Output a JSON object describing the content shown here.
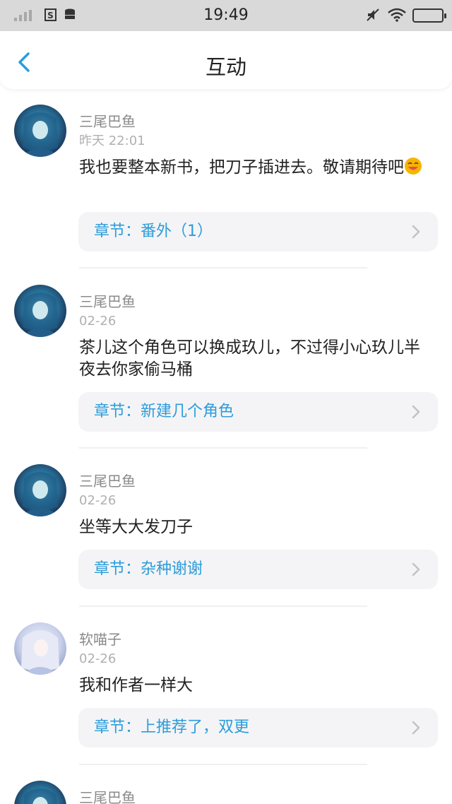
{
  "status_bar": {
    "time": "19:49",
    "icons": [
      "signal-icon",
      "sim-icon",
      "data-icon",
      "mute-icon",
      "wifi-icon",
      "battery-icon"
    ]
  },
  "nav": {
    "title": "互动",
    "back_icon": "chevron-left-icon"
  },
  "accent_color": "#2d9cdb",
  "comments": [
    {
      "user": "三尾巴鱼",
      "time": "昨天 22:01",
      "text": "我也要整本新书，把刀子插进去。敬请期待吧",
      "emoji": "smiling-emoji",
      "chapter": "章节：番外（1）"
    },
    {
      "user": "三尾巴鱼",
      "time": "02-26",
      "text": "茶儿这个角色可以换成玖儿，不过得小心玖儿半夜去你家偷马桶",
      "chapter": "章节：新建几个角色"
    },
    {
      "user": "三尾巴鱼",
      "time": "02-26",
      "text": "坐等大大发刀子",
      "chapter": "章节：杂种谢谢"
    },
    {
      "user": "软喵子",
      "time": "02-26",
      "text": "我和作者一样大",
      "chapter": "章节：上推荐了，双更"
    },
    {
      "user": "三尾巴鱼"
    }
  ]
}
